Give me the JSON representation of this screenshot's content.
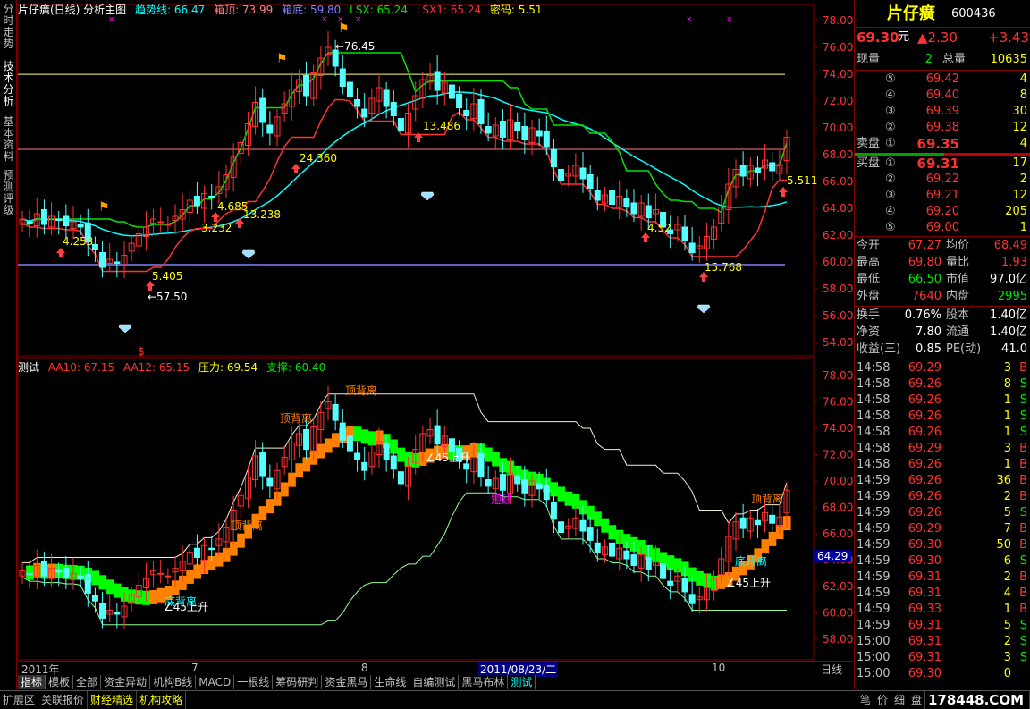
{
  "left_tabs": [
    "分时走势",
    "技术分析",
    "基本资料",
    "预测评级"
  ],
  "header": {
    "title": "片仔癀(日线) 分析主图",
    "trend_label": "趋势线: 66.47",
    "box_top": "箱顶: 73.99",
    "box_bottom": "箱底: 59.80",
    "lsx": "LSX: 65.24",
    "lsx1": "LSX1: 65.24",
    "code": "密码: 5.51"
  },
  "sub_header": {
    "title": "测试",
    "aa10": "AA10: 67.15",
    "aa12": "AA12: 65.15",
    "pressure": "压力: 69.54",
    "support": "支撑: 60.40"
  },
  "y_axis_top": [
    "78.00",
    "76.00",
    "74.00",
    "72.00",
    "70.00",
    "68.00",
    "66.00",
    "64.00",
    "62.00",
    "60.00",
    "58.00",
    "56.00",
    "54.00"
  ],
  "y_axis_bottom": [
    "78.00",
    "76.00",
    "74.00",
    "72.00",
    "70.00",
    "68.00",
    "66.00",
    "64.00",
    "62.00",
    "60.00",
    "58.00"
  ],
  "price_tag": "64.29",
  "annotations_top": [
    "76.45",
    "57.50",
    "4.253",
    "5.405",
    "3.232",
    "4.685",
    "13.238",
    "24.360",
    "13.486",
    "4.52",
    "15.768",
    "5.511"
  ],
  "annotations_bottom": [
    "顶背离",
    "顶背离",
    "顶背离",
    "顶背离",
    "底背离",
    "底背离",
    "45上升",
    "45上升",
    "45上升",
    "短线"
  ],
  "date_axis": {
    "start": "2011年",
    "m7": "7",
    "m8": "8",
    "cursor": "2011/08/23/二",
    "m10": "10",
    "period": "日线"
  },
  "bottom_tabs": [
    "指标",
    "模板",
    "全部",
    "资金异动",
    "机构B线",
    "MACD",
    "一根线",
    "筹码研判",
    "资金黑马",
    "生命线",
    "自编测试",
    "黑马布林",
    "测试"
  ],
  "status_tabs": [
    "扩展区",
    "关联报价",
    "财经精选",
    "机构攻略"
  ],
  "quote": {
    "name": "片仔癀",
    "code": "600436",
    "price": "69.30",
    "unit": "元",
    "change": "▲2.30",
    "change_pct": "+3.43",
    "now_vol_label": "现量",
    "now_vol": "2",
    "total_vol_label": "总量",
    "total_vol": "10635",
    "sells": [
      {
        "lvl": "⑤",
        "price": "69.42",
        "vol": "4"
      },
      {
        "lvl": "④",
        "price": "69.40",
        "vol": "8"
      },
      {
        "lvl": "③",
        "price": "69.39",
        "vol": "30"
      },
      {
        "lvl": "②",
        "price": "69.38",
        "vol": "12"
      }
    ],
    "sell1": {
      "label": "卖盘",
      "lvl": "①",
      "price": "69.35",
      "vol": "4"
    },
    "buy1": {
      "label": "买盘",
      "lvl": "①",
      "price": "69.31",
      "vol": "17"
    },
    "buys": [
      {
        "lvl": "②",
        "price": "69.22",
        "vol": "2"
      },
      {
        "lvl": "③",
        "price": "69.21",
        "vol": "12"
      },
      {
        "lvl": "④",
        "price": "69.20",
        "vol": "205"
      },
      {
        "lvl": "⑤",
        "price": "69.00",
        "vol": "1"
      }
    ],
    "stats": [
      {
        "l1": "今开",
        "v1": "67.27",
        "l2": "均价",
        "v2": "68.49"
      },
      {
        "l1": "最高",
        "v1": "69.80",
        "l2": "量比",
        "v2": "1.93"
      },
      {
        "l1": "最低",
        "v1": "66.50",
        "l2": "市值",
        "v2": "97.0亿"
      },
      {
        "l1": "外盘",
        "v1": "7640",
        "l2": "内盘",
        "v2": "2995"
      }
    ],
    "stats2": [
      {
        "l1": "换手",
        "v1": "0.76%",
        "l2": "股本",
        "v2": "1.40亿"
      },
      {
        "l1": "净资",
        "v1": "7.80",
        "l2": "流通",
        "v2": "1.40亿"
      },
      {
        "l1": "收益(三)",
        "v1": "0.85",
        "l2": "PE(动)",
        "v2": "41.0"
      }
    ],
    "ticks": [
      {
        "t": "14:58",
        "p": "69.29",
        "v": "3",
        "d": "B"
      },
      {
        "t": "14:58",
        "p": "69.26",
        "v": "8",
        "d": "S"
      },
      {
        "t": "14:58",
        "p": "69.26",
        "v": "1",
        "d": "S"
      },
      {
        "t": "14:58",
        "p": "69.26",
        "v": "1",
        "d": "S"
      },
      {
        "t": "14:58",
        "p": "69.26",
        "v": "1",
        "d": "S"
      },
      {
        "t": "14:58",
        "p": "69.29",
        "v": "3",
        "d": "B"
      },
      {
        "t": "14:58",
        "p": "69.26",
        "v": "1",
        "d": "B"
      },
      {
        "t": "14:59",
        "p": "69.26",
        "v": "36",
        "d": "B"
      },
      {
        "t": "14:59",
        "p": "69.26",
        "v": "2",
        "d": "B"
      },
      {
        "t": "14:59",
        "p": "69.26",
        "v": "5",
        "d": "S"
      },
      {
        "t": "14:59",
        "p": "69.29",
        "v": "7",
        "d": "B"
      },
      {
        "t": "14:59",
        "p": "69.30",
        "v": "50",
        "d": "B"
      },
      {
        "t": "14:59",
        "p": "69.30",
        "v": "6",
        "d": "S"
      },
      {
        "t": "14:59",
        "p": "69.31",
        "v": "2",
        "d": "B"
      },
      {
        "t": "14:59",
        "p": "69.31",
        "v": "4",
        "d": "B"
      },
      {
        "t": "14:59",
        "p": "69.33",
        "v": "1",
        "d": "B"
      },
      {
        "t": "14:59",
        "p": "69.31",
        "v": "5",
        "d": "S"
      },
      {
        "t": "15:00",
        "p": "69.31",
        "v": "2",
        "d": "S"
      },
      {
        "t": "15:00",
        "p": "69.31",
        "v": "3",
        "d": "S"
      },
      {
        "t": "15:00",
        "p": "69.30",
        "v": "0",
        "d": ""
      }
    ],
    "bottom_labels": [
      "笔",
      "价",
      "细",
      "盘"
    ],
    "watermark": "178448.COM"
  },
  "colors": {
    "red": "#ff3232",
    "green": "#00e600",
    "cyan": "#00ffff",
    "yellow": "#ffff00",
    "orange": "#ff8000",
    "frame": "#800000"
  }
}
